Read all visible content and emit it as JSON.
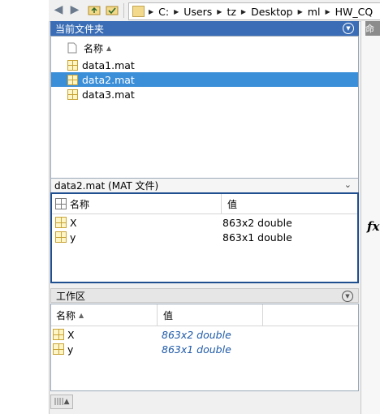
{
  "address_bar": {
    "crumbs": [
      "C:",
      "Users",
      "tz",
      "Desktop",
      "ml",
      "HW_CQ"
    ]
  },
  "current_folder": {
    "title": "当前文件夹",
    "column_name": "名称",
    "files": [
      {
        "name": "data1.mat",
        "selected": false
      },
      {
        "name": "data2.mat",
        "selected": true
      },
      {
        "name": "data3.mat",
        "selected": false
      }
    ]
  },
  "details": {
    "title": "data2.mat  (MAT 文件)",
    "col_name": "名称",
    "col_value": "值",
    "vars": [
      {
        "name": "X",
        "value": "863x2 double"
      },
      {
        "name": "y",
        "value": "863x1 double"
      }
    ]
  },
  "workspace": {
    "title": "工作区",
    "col_name": "名称",
    "col_value": "值",
    "vars": [
      {
        "name": "X",
        "value": "863x2 double"
      },
      {
        "name": "y",
        "value": "863x1 double"
      }
    ]
  },
  "command_window": {
    "partial_title": "命",
    "fx_label": "fx"
  },
  "colors": {
    "title_blue": "#3a6db5",
    "selection_blue": "#3b8fd9",
    "value_blue": "#1e5aa8"
  }
}
